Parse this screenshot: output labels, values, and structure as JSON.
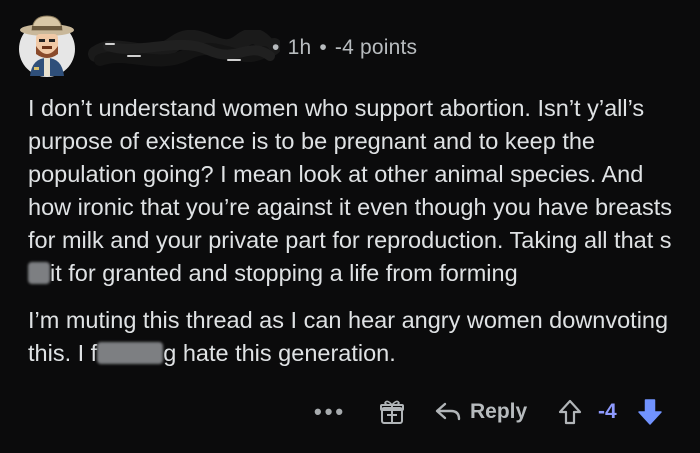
{
  "header": {
    "age": "1h",
    "separator": "•",
    "points": "-4 points"
  },
  "body": {
    "paragraph1": {
      "text_before_censor": "I don’t understand women who support abortion. Isn’t y’all’s purpose of existence is to be pregnant and to keep the population going? I mean look at other animal species. And how ironic that you’re against it even though you have breasts for milk and your private part for reproduction. Taking all that s",
      "text_after_censor": "it for granted and stopping a life from forming"
    },
    "paragraph2": {
      "text_before_censor": "I’m muting this thread as I can hear angry women downvoting this. I f",
      "text_after_censor": "g hate this generation."
    }
  },
  "actions": {
    "more_label": "•••",
    "reply_label": "Reply",
    "score": "-4"
  },
  "icons": {
    "avatar": "cartoon-cowboy-avatar",
    "award": "gift-award-icon",
    "reply": "reply-arrow-icon",
    "upvote": "upvote-arrow-icon",
    "downvote": "downvote-arrow-icon"
  },
  "colors": {
    "background": "#0b0b0c",
    "text": "#dfe2e4",
    "muted": "#b1b5b8",
    "downvote_active": "#7193ff"
  }
}
